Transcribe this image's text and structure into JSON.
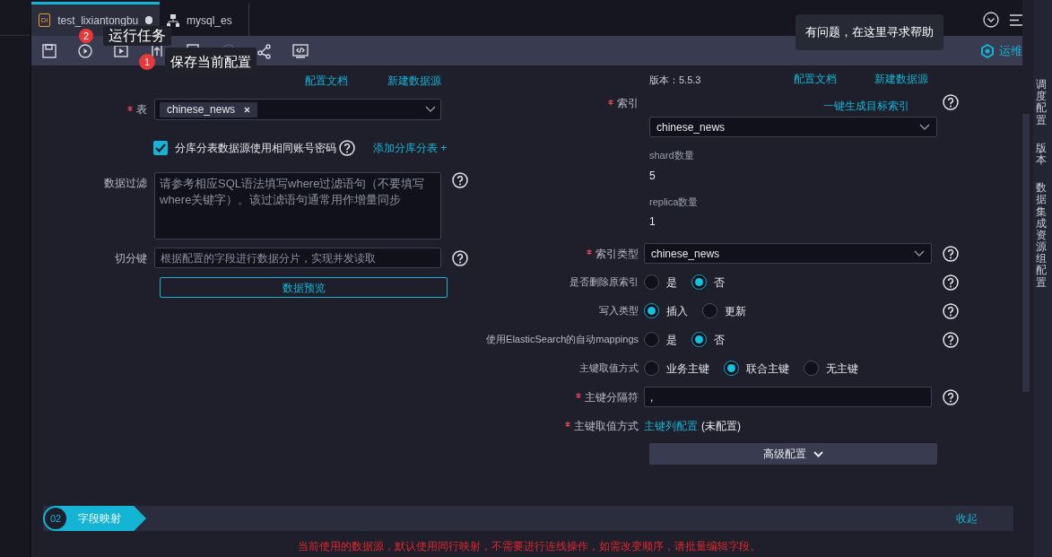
{
  "tabs": [
    {
      "label": "test_lixiantongbu",
      "kind": "di",
      "badge": "Di",
      "selected": true,
      "unsaved": true
    },
    {
      "label": "mysql_es",
      "kind": "network",
      "selected": false,
      "unsaved": false
    }
  ],
  "tooltips": [
    {
      "badge": "2",
      "text": "运行任务"
    },
    {
      "badge": "1",
      "text": "保存当前配置"
    }
  ],
  "help_tip": "有问题，在这里寻求帮助",
  "ops_label": "运维",
  "source": {
    "links": [
      "配置文档",
      "新建数据源"
    ],
    "table": {
      "label": "表",
      "required": true,
      "tags": [
        "chinese_news"
      ]
    },
    "same_account": {
      "label": "分库分表数据源使用相同账号密码",
      "checked": true,
      "link": "添加分库分表 +"
    },
    "filter": {
      "label": "数据过滤",
      "placeholder": "请参考相应SQL语法填写where过滤语句（不要填写where关键字）。该过滤语句通常用作增量同步"
    },
    "split_key": {
      "label": "切分键",
      "placeholder": "根据配置的字段进行数据分片，实现并发读取"
    },
    "preview_button": "数据预览"
  },
  "target": {
    "version": "版本：5.5.3",
    "links": [
      "配置文档",
      "新建数据源"
    ],
    "index": {
      "label": "索引",
      "required": true,
      "link": "一键生成目标索引",
      "value": "chinese_news"
    },
    "stats": [
      {
        "label": "shard数量",
        "value": "5"
      },
      {
        "label": "replica数量",
        "value": "1"
      }
    ],
    "index_type": {
      "label": "索引类型",
      "required": true,
      "value": "chinese_news"
    },
    "radio_groups": [
      {
        "label": "是否删除原索引",
        "help": true,
        "options": [
          {
            "label": "是",
            "selected": false
          },
          {
            "label": "否",
            "selected": true
          }
        ]
      },
      {
        "label": "写入类型",
        "help": true,
        "options": [
          {
            "label": "插入",
            "selected": true
          },
          {
            "label": "更新",
            "selected": false
          }
        ]
      },
      {
        "label": "使用ElasticSearch的自动mappings",
        "help": true,
        "options": [
          {
            "label": "是",
            "selected": false
          },
          {
            "label": "否",
            "selected": true
          }
        ]
      },
      {
        "label": "主键取值方式",
        "help": false,
        "options": [
          {
            "label": "业务主键",
            "selected": false
          },
          {
            "label": "联合主键",
            "selected": true
          },
          {
            "label": "无主键",
            "selected": false
          }
        ]
      }
    ],
    "delimiter": {
      "label": "主键分隔符",
      "required": true,
      "value": ","
    },
    "pk_config": {
      "label": "主键取值方式",
      "required": true,
      "link": "主键列配置",
      "note": "(未配置)"
    },
    "advanced_button": "高级配置"
  },
  "section": {
    "number": "02",
    "title": "字段映射",
    "action": "收起"
  },
  "notice": "当前使用的数据源，默认使用同行映射，不需要进行连线操作，如需改变顺序，请批量编辑字段。",
  "side_panel": [
    "调度配置",
    "版本",
    "数据集成资源组配置"
  ]
}
